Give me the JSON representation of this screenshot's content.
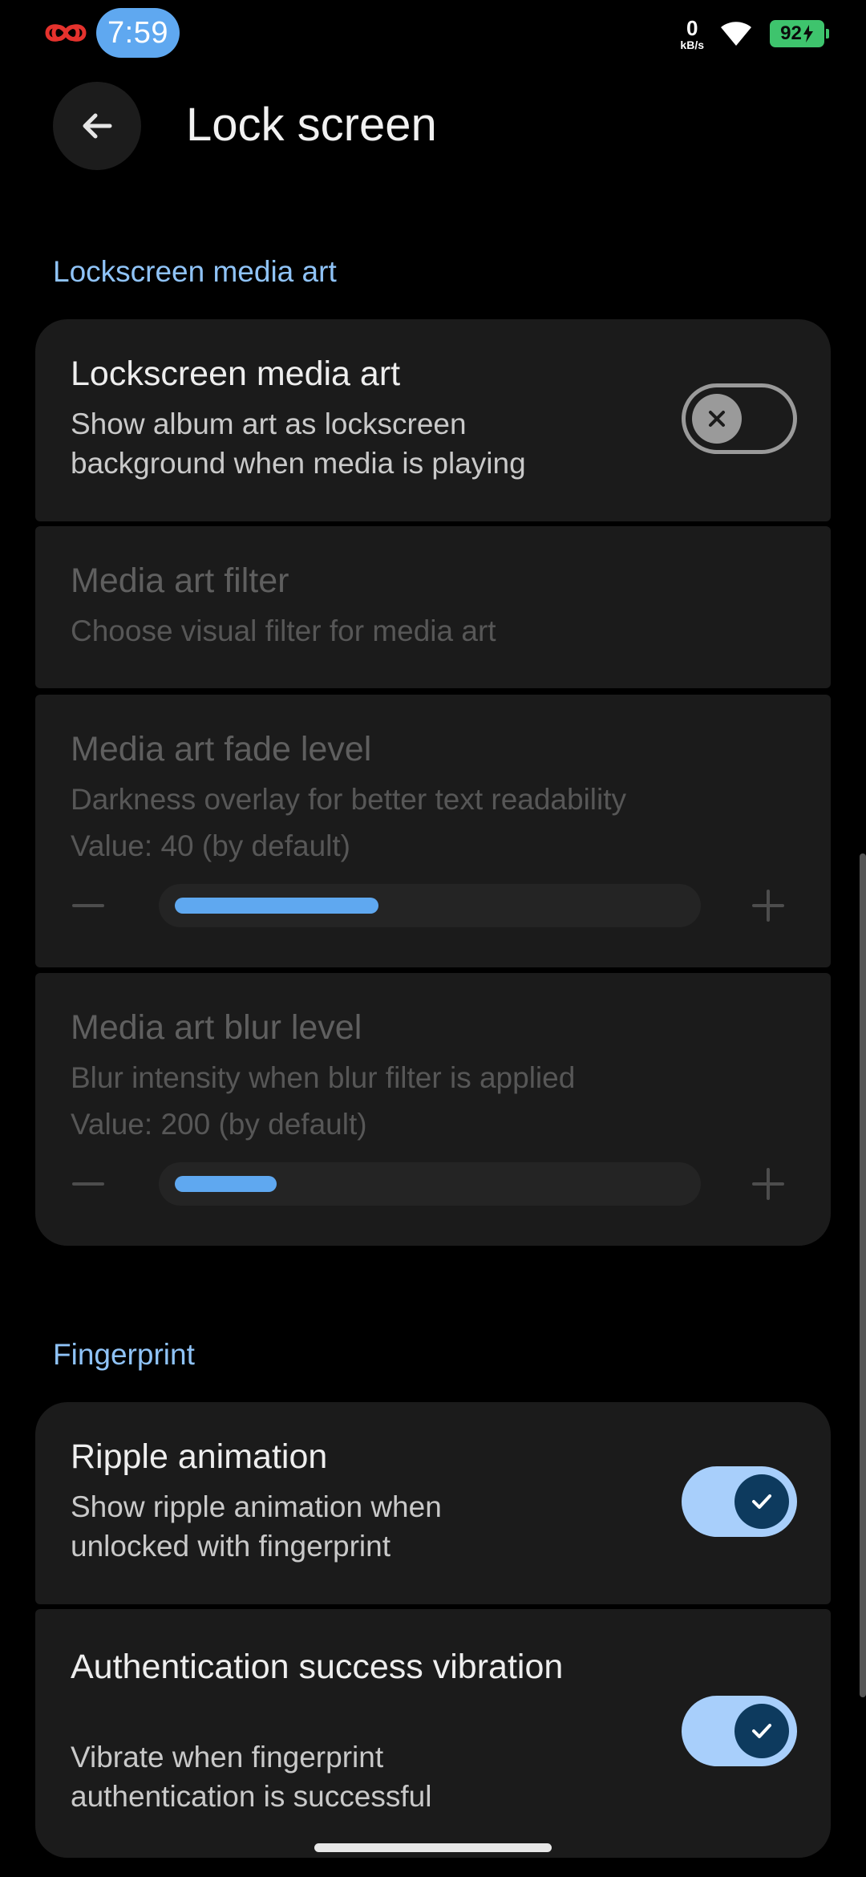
{
  "status_bar": {
    "time": "7:59",
    "net_speed_value": "0",
    "net_speed_unit": "kB/s",
    "battery_level": "92",
    "icons": [
      "infinity-icon",
      "wifi-icon",
      "battery-charging-icon"
    ]
  },
  "header": {
    "title": "Lock screen",
    "back_icon": "arrow-back-icon"
  },
  "sections": {
    "media_art": {
      "header": "Lockscreen media art",
      "toggle_item": {
        "title": "Lockscreen media art",
        "description": "Show album art as lockscreen background when media is playing",
        "enabled": false
      },
      "filter_item": {
        "title": "Media art filter",
        "description": "Choose visual filter for media art"
      },
      "fade_item": {
        "title": "Media art fade level",
        "description": "Darkness overlay for better text readability",
        "value_text": "Value: 40 (by default)",
        "value": 40,
        "max": 100
      },
      "blur_item": {
        "title": "Media art blur level",
        "description": "Blur intensity when blur filter is applied",
        "value_text": "Value: 200 (by default)",
        "value": 200,
        "max": 1000
      }
    },
    "fingerprint": {
      "header": "Fingerprint",
      "ripple_item": {
        "title": "Ripple animation",
        "description": "Show ripple animation when unlocked with fingerprint",
        "enabled": true
      },
      "vibration_item": {
        "title": "Authentication success vibration",
        "description": "Vibrate when fingerprint authentication is successful",
        "enabled": true
      }
    }
  },
  "colors": {
    "background": "#000000",
    "card": "#1b1b1b",
    "accent": "#8fc3f7",
    "toggle_on_track": "#a8cffb",
    "toggle_on_knob": "#0d3a5e",
    "slider_fill": "#5fa8f0",
    "battery": "#3ec46d"
  }
}
